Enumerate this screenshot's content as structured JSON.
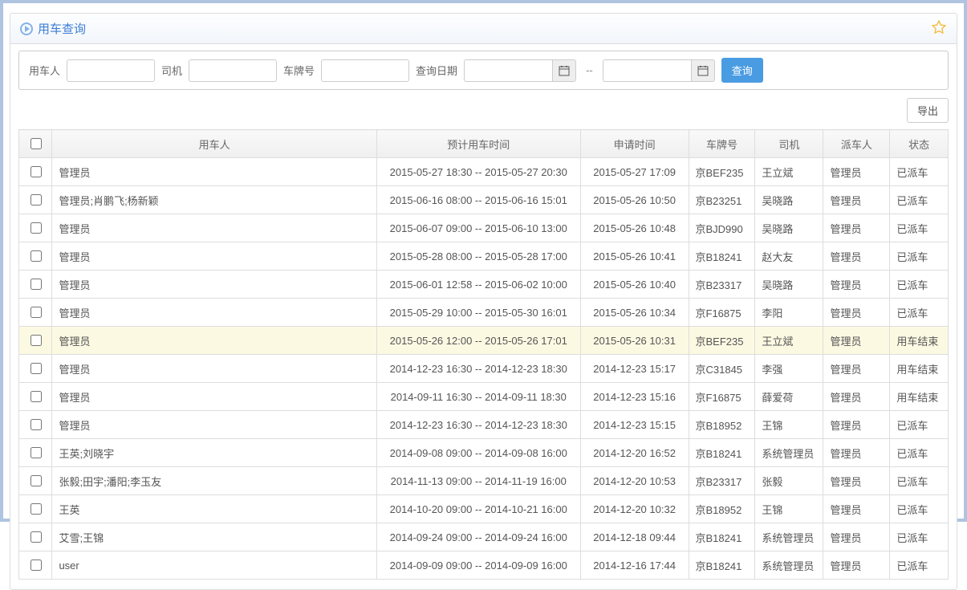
{
  "header": {
    "title": "用车查询"
  },
  "search": {
    "user_label": "用车人",
    "driver_label": "司机",
    "plate_label": "车牌号",
    "date_label": "查询日期",
    "query_btn": "查询"
  },
  "buttons": {
    "export": "导出"
  },
  "table": {
    "columns": {
      "user": "用车人",
      "est_time": "预计用车时间",
      "apply_time": "申请时间",
      "plate": "车牌号",
      "driver": "司机",
      "dispatcher": "派车人",
      "status": "状态"
    },
    "rows": [
      {
        "user": "管理员",
        "est": "2015-05-27 18:30 -- 2015-05-27 20:30",
        "apply": "2015-05-27 17:09",
        "plate": "京BEF235",
        "driver": "王立斌",
        "disp": "管理员",
        "status": "已派车"
      },
      {
        "user": "管理员;肖鹏飞;杨新颖",
        "est": "2015-06-16 08:00 -- 2015-06-16 15:01",
        "apply": "2015-05-26 10:50",
        "plate": "京B23251",
        "driver": "吴晓路",
        "disp": "管理员",
        "status": "已派车"
      },
      {
        "user": "管理员",
        "est": "2015-06-07 09:00 -- 2015-06-10 13:00",
        "apply": "2015-05-26 10:48",
        "plate": "京BJD990",
        "driver": "吴晓路",
        "disp": "管理员",
        "status": "已派车"
      },
      {
        "user": "管理员",
        "est": "2015-05-28 08:00 -- 2015-05-28 17:00",
        "apply": "2015-05-26 10:41",
        "plate": "京B18241",
        "driver": "赵大友",
        "disp": "管理员",
        "status": "已派车"
      },
      {
        "user": "管理员",
        "est": "2015-06-01 12:58 -- 2015-06-02 10:00",
        "apply": "2015-05-26 10:40",
        "plate": "京B23317",
        "driver": "吴晓路",
        "disp": "管理员",
        "status": "已派车"
      },
      {
        "user": "管理员",
        "est": "2015-05-29 10:00 -- 2015-05-30 16:01",
        "apply": "2015-05-26 10:34",
        "plate": "京F16875",
        "driver": "李阳",
        "disp": "管理员",
        "status": "已派车"
      },
      {
        "user": "管理员",
        "est": "2015-05-26 12:00 -- 2015-05-26 17:01",
        "apply": "2015-05-26 10:31",
        "plate": "京BEF235",
        "driver": "王立斌",
        "disp": "管理员",
        "status": "用车结束",
        "highlight": true
      },
      {
        "user": "管理员",
        "est": "2014-12-23 16:30 -- 2014-12-23 18:30",
        "apply": "2014-12-23 15:17",
        "plate": "京C31845",
        "driver": "李强",
        "disp": "管理员",
        "status": "用车结束"
      },
      {
        "user": "管理员",
        "est": "2014-09-11 16:30 -- 2014-09-11 18:30",
        "apply": "2014-12-23 15:16",
        "plate": "京F16875",
        "driver": "薛爱荷",
        "disp": "管理员",
        "status": "用车结束"
      },
      {
        "user": "管理员",
        "est": "2014-12-23 16:30 -- 2014-12-23 18:30",
        "apply": "2014-12-23 15:15",
        "plate": "京B18952",
        "driver": "王锦",
        "disp": "管理员",
        "status": "已派车"
      },
      {
        "user": "王英;刘晓宇",
        "est": "2014-09-08 09:00 -- 2014-09-08 16:00",
        "apply": "2014-12-20 16:52",
        "plate": "京B18241",
        "driver": "系统管理员",
        "disp": "管理员",
        "status": "已派车"
      },
      {
        "user": "张毅;田宇;潘阳;李玉友",
        "est": "2014-11-13 09:00 -- 2014-11-19 16:00",
        "apply": "2014-12-20 10:53",
        "plate": "京B23317",
        "driver": "张毅",
        "disp": "管理员",
        "status": "已派车"
      },
      {
        "user": "王英",
        "est": "2014-10-20 09:00 -- 2014-10-21 16:00",
        "apply": "2014-12-20 10:32",
        "plate": "京B18952",
        "driver": "王锦",
        "disp": "管理员",
        "status": "已派车"
      },
      {
        "user": "艾雪;王锦",
        "est": "2014-09-24 09:00 -- 2014-09-24 16:00",
        "apply": "2014-12-18 09:44",
        "plate": "京B18241",
        "driver": "系统管理员",
        "disp": "管理员",
        "status": "已派车"
      },
      {
        "user": "user",
        "est": "2014-09-09 09:00 -- 2014-09-09 16:00",
        "apply": "2014-12-16 17:44",
        "plate": "京B18241",
        "driver": "系统管理员",
        "disp": "管理员",
        "status": "已派车"
      }
    ]
  }
}
